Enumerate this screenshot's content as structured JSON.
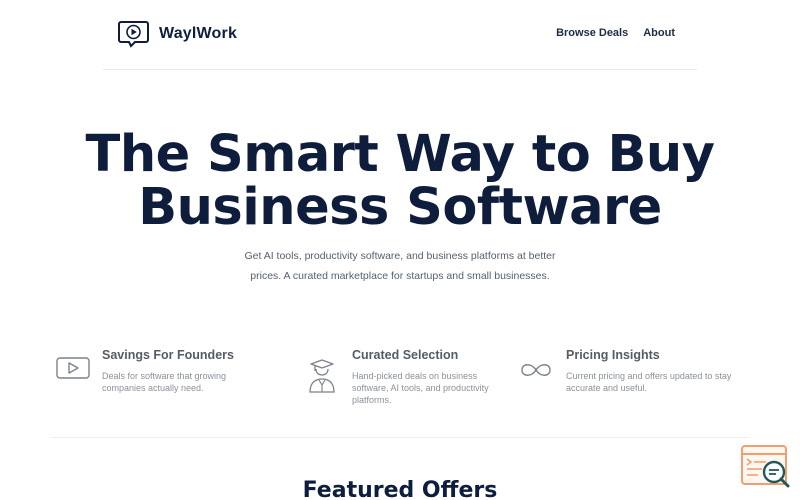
{
  "header": {
    "brand": "WaylWork",
    "nav": [
      "Browse Deals",
      "About"
    ]
  },
  "hero": {
    "title_line1": "The Smart Way to Buy",
    "title_line2": "Business Software",
    "subtitle": "Get AI tools, productivity software, and business platforms at better prices. A curated marketplace for startups and small businesses."
  },
  "features": [
    {
      "icon": "play-video-icon",
      "title": "Savings For Founders",
      "desc": "Deals for software that growing companies actually need."
    },
    {
      "icon": "graduate-icon",
      "title": "Curated Selection",
      "desc": "Hand-picked deals on business software, AI tools, and productivity platforms."
    },
    {
      "icon": "infinity-icon",
      "title": "Pricing Insights",
      "desc": "Current pricing and offers updated to stay accurate and useful."
    }
  ],
  "featured": {
    "title": "Featured Offers"
  },
  "widget": {
    "icon": "code-search-icon"
  },
  "colors": {
    "navy": "#0f1d3d",
    "muted": "#8a919b",
    "widget_orange": "#f0a070",
    "widget_teal": "#1f5a5a"
  }
}
